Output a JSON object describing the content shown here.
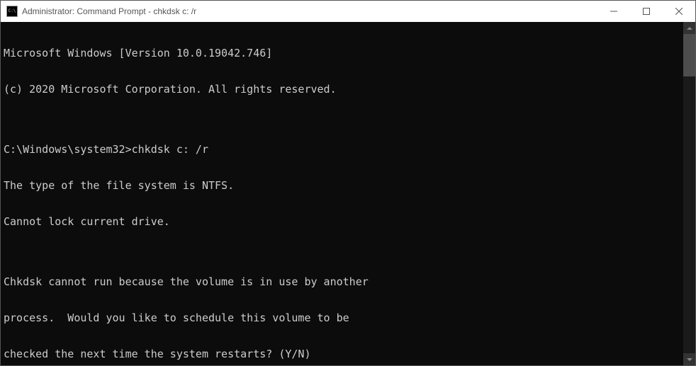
{
  "window": {
    "title": "Administrator: Command Prompt - chkdsk  c: /r",
    "icon_label": "cmd-icon"
  },
  "controls": {
    "minimize": "Minimize",
    "maximize": "Maximize",
    "close": "Close"
  },
  "terminal": {
    "lines": [
      "Microsoft Windows [Version 10.0.19042.746]",
      "(c) 2020 Microsoft Corporation. All rights reserved.",
      "",
      "C:\\Windows\\system32>chkdsk c: /r",
      "The type of the file system is NTFS.",
      "Cannot lock current drive.",
      "",
      "Chkdsk cannot run because the volume is in use by another",
      "process.  Would you like to schedule this volume to be",
      "checked the next time the system restarts? (Y/N)"
    ]
  }
}
